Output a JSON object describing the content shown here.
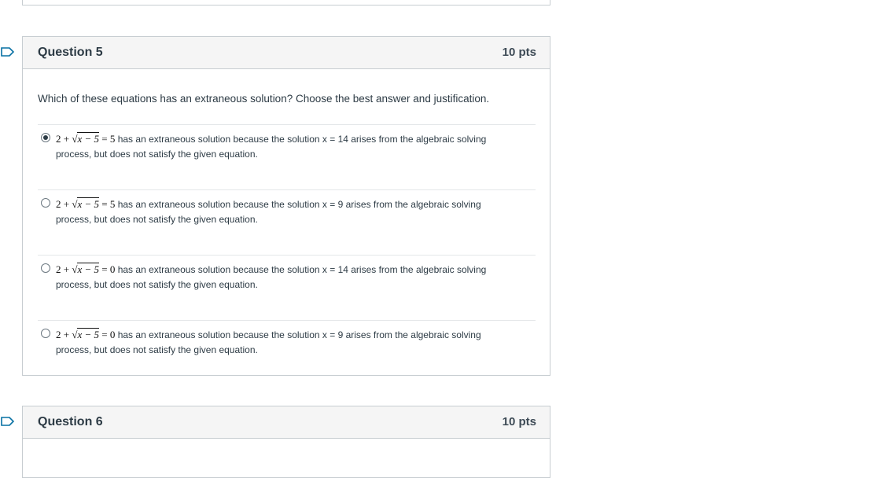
{
  "questions": [
    {
      "title": "Question 5",
      "points": "10 pts",
      "text": "Which of these equations has an extraneous solution? Choose the best answer and justification.",
      "answers": [
        {
          "lhs": "2 + ",
          "radicand": "x − 5",
          "eq": " = 5",
          "desc": " has an extraneous solution because the solution x = 14 arises from the algebraic solving",
          "desc2": "process, but does not satisfy the given equation.",
          "selected": true
        },
        {
          "lhs": "2 + ",
          "radicand": "x − 5",
          "eq": " = 5",
          "desc": " has an extraneous solution because the solution x = 9 arises from the algebraic solving",
          "desc2": "process, but does not satisfy the given equation.",
          "selected": false
        },
        {
          "lhs": "2 + ",
          "radicand": "x − 5",
          "eq": " = 0",
          "desc": " has an extraneous solution because the solution x = 14 arises from the algebraic solving",
          "desc2": "process, but does not satisfy the given equation.",
          "selected": false
        },
        {
          "lhs": "2 + ",
          "radicand": "x − 5",
          "eq": " = 0",
          "desc": " has an extraneous solution because the solution x = 9 arises from the algebraic solving",
          "desc2": "process, but does not satisfy the given equation.",
          "selected": false
        }
      ]
    },
    {
      "title": "Question 6",
      "points": "10 pts"
    }
  ],
  "colors": {
    "flag": "#0770a3",
    "header_bg": "#f5f5f5",
    "border": "#c7cdd1"
  },
  "icons": {
    "flag": "flag-icon",
    "radio_on": "radio-selected-icon",
    "radio_off": "radio-unselected-icon"
  }
}
